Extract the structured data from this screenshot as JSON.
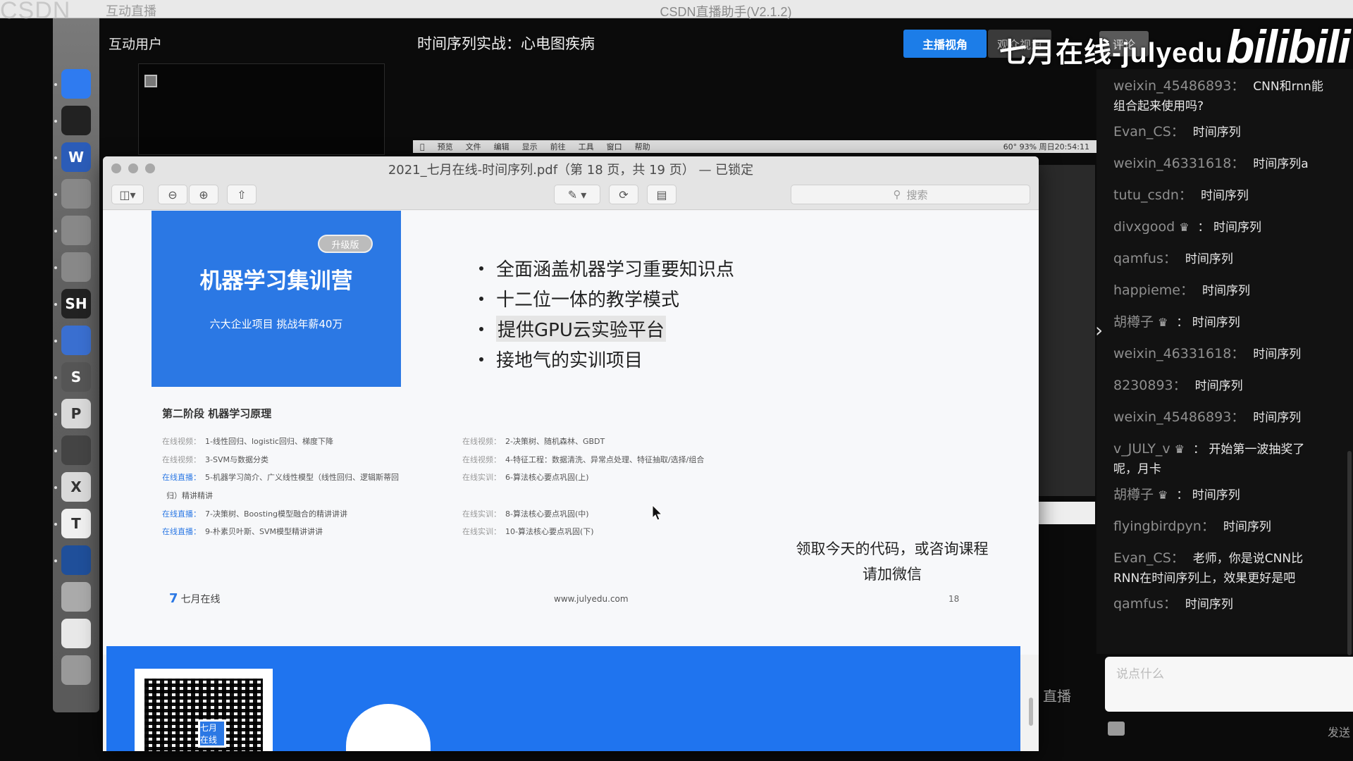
{
  "window": {
    "app_brand": "CSDN",
    "menu_text": "互动直播",
    "title": "CSDN直播助手(V2.1.2)"
  },
  "panel": {
    "interaction_title": "互动用户",
    "stream_title": "时间序列实战：心电图疾病",
    "host_view_label": "主播视角",
    "viewer_view_label": "观众视角",
    "comment_label": "评论",
    "watermark": "七月在线-julyedu",
    "bilibili": "bilibili",
    "accent_color": "#1c7de8"
  },
  "mac_menu": {
    "items": [
      "预览",
      "文件",
      "编辑",
      "显示",
      "前往",
      "工具",
      "窗口",
      "帮助"
    ],
    "status": "60°  93%  周日20:54:11"
  },
  "pdf": {
    "title": "2021_七月在线-时间序列.pdf（第 18 页，共 19 页） — 已锁定",
    "search_placeholder": "搜索",
    "promo": {
      "badge": "升级版",
      "title": "机器学习集训营",
      "subtitle": "六大企业项目  挑战年薪40万",
      "color": "#2b78e4"
    },
    "bullets": [
      "全面涵盖机器学习重要知识点",
      "十二位一体的教学模式",
      "提供GPU云实验平台",
      "接地气的实训项目"
    ],
    "stage_heading": "第二阶段  机器学习原理",
    "courses_left": [
      {
        "tag": "在线视频：",
        "text": "1-线性回归、logistic回归、梯度下降",
        "live": false
      },
      {
        "tag": "在线视频：",
        "text": "3-SVM与数据分类",
        "live": false
      },
      {
        "tag": "在线直播：",
        "text": "5-机器学习简介、广义线性模型（线性回归、逻辑斯蒂回",
        "live": true
      },
      {
        "tag": "",
        "text": "归）精讲精讲",
        "live": false
      },
      {
        "tag": "在线直播：",
        "text": "7-决策树、Boosting模型融合的精讲讲讲",
        "live": true
      },
      {
        "tag": "在线直播：",
        "text": "9-朴素贝叶斯、SVM模型精讲讲讲",
        "live": true
      }
    ],
    "courses_right": [
      {
        "tag": "在线视频：",
        "text": "2-决策树、随机森林、GBDT"
      },
      {
        "tag": "在线视频：",
        "text": "4-特征工程：数据清洗、异常点处理、特征抽取/选择/组合"
      },
      {
        "tag": "在线实训：",
        "text": "6-算法核心要点巩固(上)"
      },
      {
        "tag": "在线实训：",
        "text": "8-算法核心要点巩固(中)"
      },
      {
        "tag": "在线实训：",
        "text": "10-算法核心要点巩固(下)"
      }
    ],
    "consult_line1": "领取今天的代码，或咨询课程",
    "consult_line2": "请加微信",
    "logo_text": "七月在线",
    "logo_mark": "7",
    "footer_url": "www.julyedu.com",
    "page_number": "18",
    "qr_logo": "七月在线"
  },
  "chat": {
    "messages": [
      {
        "user": "weixin_45486893：",
        "msg": "CNN和rnn能",
        "cont": "组合起来使用吗?"
      },
      {
        "user": "Evan_CS：",
        "msg": "时间序列"
      },
      {
        "user": "weixin_46331618：",
        "msg": "时间序列a"
      },
      {
        "user": "tutu_csdn：",
        "msg": "时间序列"
      },
      {
        "user": "divxgood",
        "crown": "♛",
        "msg": "： 时间序列"
      },
      {
        "user": "qamfus：",
        "msg": "时间序列"
      },
      {
        "user": "happieme：",
        "msg": "时间序列"
      },
      {
        "user": "胡樽子",
        "crown": "♛",
        "msg": "： 时间序列"
      },
      {
        "user": "weixin_46331618：",
        "msg": "时间序列"
      },
      {
        "user": "8230893：",
        "msg": "时间序列"
      },
      {
        "user": "weixin_45486893：",
        "msg": "时间序列"
      },
      {
        "user": "v_JULY_v",
        "crown": "♛",
        "msg": "： 开始第一波抽奖了",
        "cont": "呢，月卡"
      },
      {
        "user": "胡樽子",
        "crown": "♛",
        "msg": "： 时间序列"
      },
      {
        "user": "flyingbirdpyn：",
        "msg": "时间序列"
      },
      {
        "user": "Evan_CS：",
        "msg": "老师，你是说CNN比",
        "cont": "RNN在时间序列上，效果更好是吧"
      },
      {
        "user": "qamfus：",
        "msg": "时间序列"
      }
    ],
    "input_placeholder": "说点什么",
    "send_label": "发送",
    "live_label": "直播"
  },
  "dock": {
    "items": [
      "finder-icon",
      "qq-icon",
      "word-icon",
      "wechat-icon",
      "wechat-icon",
      "wechat-icon",
      "terminal-icon",
      "chrome-icon",
      "sublime-icon",
      "powerpoint-icon",
      "telegram-icon",
      "excel-icon",
      "typora-icon",
      "video-icon",
      "preview-icon",
      "document-icon",
      "trash-icon"
    ],
    "labels": [
      "",
      "",
      "W",
      "",
      "",
      "",
      "SH",
      "",
      "S",
      "P",
      "",
      "X",
      "T",
      "",
      "",
      "",
      ""
    ]
  }
}
